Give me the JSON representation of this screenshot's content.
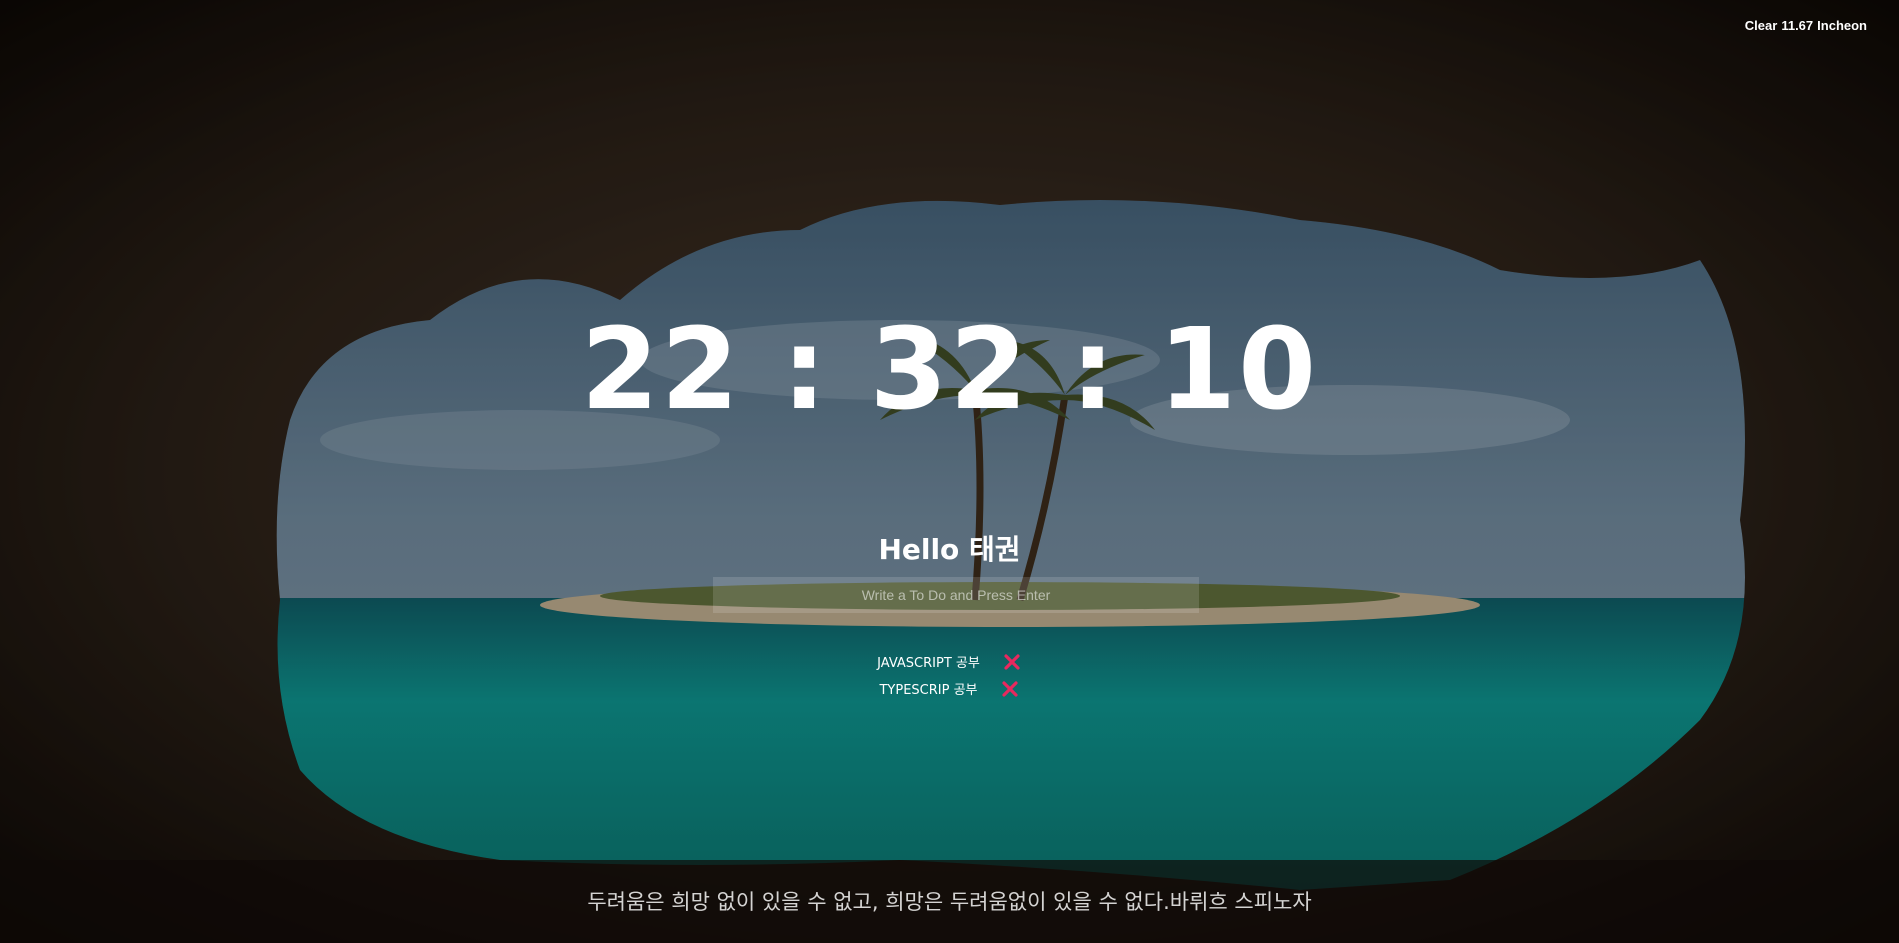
{
  "weather": {
    "condition": "Clear",
    "temperature": "11.67",
    "city": "Incheon"
  },
  "clock": {
    "hours": "22",
    "minutes": "32",
    "seconds": "10",
    "separator": ":"
  },
  "greeting": {
    "text": "Hello 태권"
  },
  "todo": {
    "placeholder": "Write a To Do and Press Enter",
    "items": [
      {
        "text": "JAVASCRIPT 공부",
        "delete_icon": "close-x-icon"
      },
      {
        "text": "TYPESCRIP 공부",
        "delete_icon": "close-x-icon"
      }
    ]
  },
  "quote": {
    "text": "두려움은 희망 없이 있을 수 없고, 희망은 두려움없이 있을 수 없다.바뤼흐 스피노자"
  },
  "colors": {
    "delete_icon": "#e8285e",
    "text": "#ffffff"
  },
  "background": {
    "description_icon": "cave-beach-palm-background"
  }
}
